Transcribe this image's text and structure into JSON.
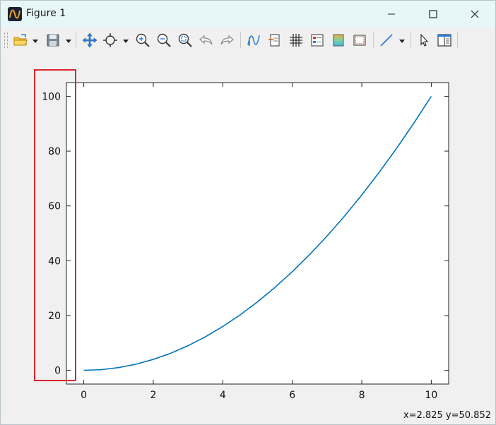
{
  "window": {
    "title": "Figure 1",
    "controls": [
      "minimize",
      "maximize",
      "close"
    ]
  },
  "toolbar": {
    "buttons": [
      "open-folder-icon",
      "save-icon",
      "pan-icon",
      "zoom-data-icon",
      "zoom-in-icon",
      "zoom-out-icon",
      "zoom-fit-icon",
      "undo-icon",
      "redo-icon",
      "curve-style-icon",
      "legend-icon",
      "grid-icon",
      "properties-icon",
      "colorbar-icon",
      "axes-frame-icon",
      "line-style-icon",
      "select-cursor-icon",
      "panel-layout-icon"
    ]
  },
  "status": {
    "coordinates": "x=2.825 y=50.852"
  },
  "colors": {
    "line": "#0072bd",
    "highlight": "#d9262c",
    "titlebar": "#e7f6f7"
  },
  "chart_data": {
    "type": "line",
    "title": "",
    "xlabel": "",
    "ylabel": "",
    "xlim": [
      -0.5,
      10.5
    ],
    "ylim": [
      -5,
      105
    ],
    "xticks": [
      0,
      2,
      4,
      6,
      8,
      10
    ],
    "yticks": [
      0,
      20,
      40,
      60,
      80,
      100
    ],
    "grid": false,
    "series": [
      {
        "x": [
          0,
          0.5,
          1,
          1.5,
          2,
          2.5,
          3,
          3.5,
          4,
          4.5,
          5,
          5.5,
          6,
          6.5,
          7,
          7.5,
          8,
          8.5,
          9,
          9.5,
          10
        ],
        "y": [
          0,
          0.25,
          1,
          2.25,
          4,
          6.25,
          9,
          12.25,
          16,
          20.25,
          25,
          30.25,
          36,
          42.25,
          49,
          56.25,
          64,
          72.25,
          81,
          90.25,
          100
        ]
      }
    ]
  }
}
